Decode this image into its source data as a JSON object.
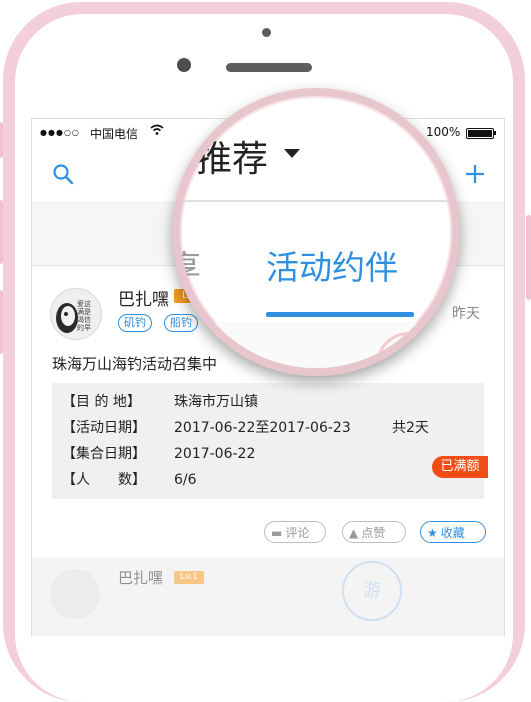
{
  "status_bar": {
    "signal": "●●●○○",
    "carrier": "中国电信",
    "wifi_icon": "wifi-icon",
    "battery": "100%"
  },
  "nav": {
    "title": "推荐",
    "search_icon": "search-icon",
    "add_icon": "plus-icon"
  },
  "tabs": {
    "left_partial": "享",
    "active": "活动约伴"
  },
  "post": {
    "username": "巴扎嘿",
    "level": "Lv.",
    "tags": [
      "矶钓",
      "船钓"
    ],
    "time": "昨天",
    "title": "珠海万山海钓活动召集中",
    "avatar_text": [
      "爱这",
      "满是",
      "渴信",
      "的早"
    ],
    "details": [
      {
        "label": "【目 的 地】",
        "value": "珠海市万山镇"
      },
      {
        "label": "【活动日期】",
        "value": "2017-06-22至2017-06-23"
      },
      {
        "label": "【集合日期】",
        "value": "2017-06-22"
      },
      {
        "label": "【人　　数】",
        "value": "6/6"
      }
    ],
    "total_days": "共2天",
    "status_badge": "已满额",
    "actions": {
      "comment": "评论",
      "like": "点赞",
      "favorite": "收藏"
    }
  },
  "next_post": {
    "username": "巴扎嘿",
    "level": "Lv.1",
    "seal": "游"
  },
  "colors": {
    "accent": "#2f8fe0",
    "badge_orange": "#f39a24",
    "full_red": "#f04e16",
    "frame_pink": "#f3cfd9"
  }
}
